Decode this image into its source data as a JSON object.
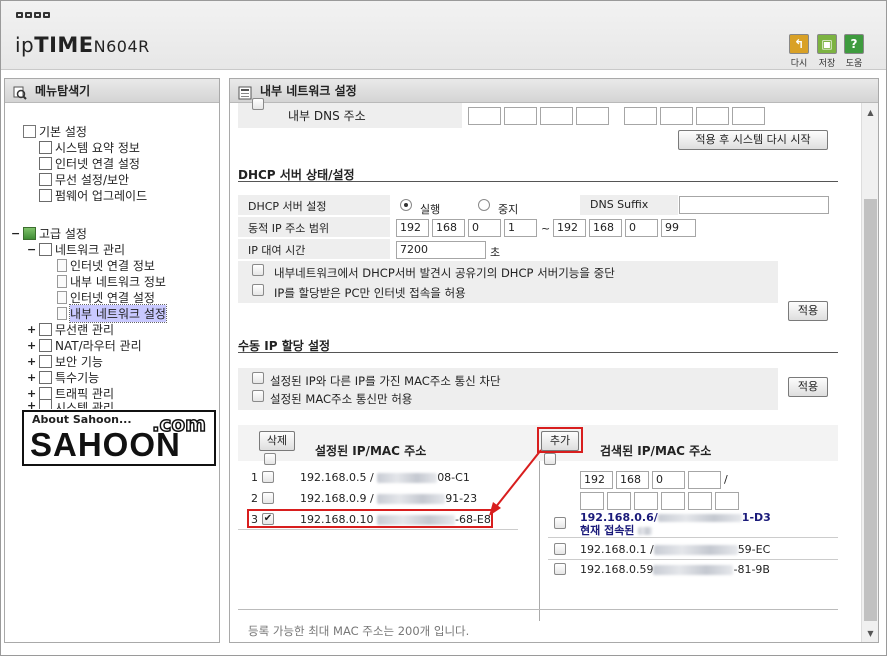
{
  "header": {
    "brand_prefix": "ip",
    "brand_main": "TIME",
    "model": "N604R",
    "buttons": [
      {
        "label": "다시",
        "icon": "undo-icon",
        "color": "#d9a126"
      },
      {
        "label": "저장",
        "icon": "save-icon",
        "color": "#7cb341"
      },
      {
        "label": "도움",
        "icon": "help-icon",
        "color": "#3e9b3e"
      }
    ]
  },
  "left_panel": {
    "title": "메뉴탐색기",
    "tree": [
      {
        "label": "기본 설정"
      },
      {
        "label": "시스템 요약 정보"
      },
      {
        "label": "인터넷 연결 설정"
      },
      {
        "label": "무선 설정/보안"
      },
      {
        "label": "펌웨어 업그레이드"
      },
      {
        "label": "고급 설정"
      },
      {
        "label": "네트워크 관리"
      },
      {
        "label": "인터넷 연결 정보"
      },
      {
        "label": "내부 네트워크 정보"
      },
      {
        "label": "인터넷 연결 설정"
      },
      {
        "label": "내부 네트워크 설정"
      },
      {
        "label": "무선랜 관리"
      },
      {
        "label": "NAT/라우터 관리"
      },
      {
        "label": "보안 기능"
      },
      {
        "label": "특수기능"
      },
      {
        "label": "트래픽 관리"
      },
      {
        "label": "시스템 관리"
      }
    ],
    "watermark": {
      "about": "About Sahoon...",
      "com": ".com",
      "name": "SAHOON"
    }
  },
  "right_panel": {
    "title": "내부 네트워크 설정",
    "dns": {
      "label": "내부 DNS 주소",
      "apply_restart_button": "적용 후 시스템 다시 시작"
    },
    "dhcp": {
      "section_title": "DHCP 서버 상태/설정",
      "server_label": "DHCP 서버 설정",
      "run_label": "실행",
      "stop_label": "중지",
      "run_selected": true,
      "dns_suffix_label": "DNS Suffix",
      "dns_suffix_value": "",
      "range_label": "동적 IP 주소 범위",
      "range_start": [
        "192",
        "168",
        "0",
        "1"
      ],
      "range_tilde": "~",
      "range_end": [
        "192",
        "168",
        "0",
        "99"
      ],
      "lease_label": "IP 대여 시간",
      "lease_value": "7200",
      "lease_unit": "초",
      "option1": "내부네트워크에서 DHCP서버 발견시 공유기의 DHCP 서버기능을 중단",
      "option2": "IP를 할당받은 PC만 인터넷 접속을 허용",
      "apply_button": "적용"
    },
    "manual": {
      "section_title": "수동 IP 할당 설정",
      "option1": "설정된 IP와 다른 IP를 가진 MAC주소 통신 차단",
      "option2": "설정된 MAC주소 통신만 허용",
      "apply_button": "적용",
      "delete_button": "삭제",
      "configured_title": "설정된 IP/MAC 주소",
      "add_button": "추가",
      "searched_title": "검색된 IP/MAC 주소",
      "configured": [
        {
          "index": "1",
          "ip": "192.168.0.5 /",
          "mac_tail": "08-C1",
          "checked": false
        },
        {
          "index": "2",
          "ip": "192.168.0.9 /",
          "mac_tail": "91-23",
          "checked": false
        },
        {
          "index": "3",
          "ip": "192.168.0.10",
          "mac_tail": "-68-E8",
          "checked": true
        }
      ],
      "new_ip": [
        "192",
        "168",
        "0",
        ""
      ],
      "slash": "/",
      "searched": [
        {
          "ip": "192.168.0.6/",
          "mac_tail": "1-D3",
          "note": "현재 접속된"
        },
        {
          "ip": "192.168.0.1 /",
          "mac_tail": "59-EC"
        },
        {
          "ip": "192.168.0.59",
          "mac_tail": "-81-9B"
        }
      ],
      "footer": "등록 가능한 최대 MAC 주소는 200개 입니다."
    }
  }
}
